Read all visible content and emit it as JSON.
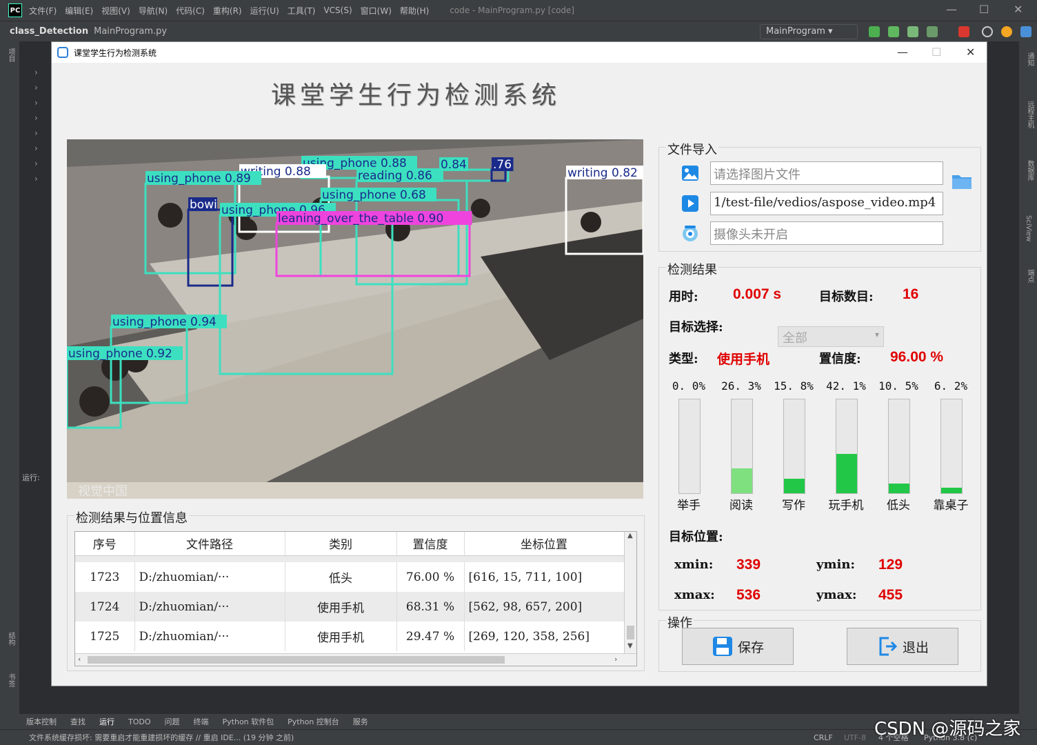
{
  "ide": {
    "logo": "PC",
    "menu": [
      "文件(F)",
      "编辑(E)",
      "视图(V)",
      "导航(N)",
      "代码(C)",
      "重构(R)",
      "运行(U)",
      "工具(T)",
      "VCS(S)",
      "窗口(W)",
      "帮助(H)"
    ],
    "title": "code - MainProgram.py [code]",
    "breadcrumb_project": "class_Detection",
    "breadcrumb_file": "MainProgram.py",
    "run_config": "MainProgram",
    "run_label": "运行:",
    "left_tab": "项目",
    "right_tabs": [
      "通知",
      "远程主机",
      "数据库",
      "SciView",
      "端点"
    ],
    "left_bottom_tabs": [
      "结构",
      "书签"
    ],
    "bottom_tabs": [
      "版本控制",
      "查找",
      "运行",
      "TODO",
      "问题",
      "终端",
      "Python 软件包",
      "Python 控制台",
      "服务"
    ],
    "status_message": "文件系统缓存损坏: 需要重启才能重建损坏的缓存 // 重启 IDE... (19 分钟 之前)",
    "status_right": [
      "CRLF",
      "UTF-8",
      "4 个空格",
      "Python 3.8 (c)"
    ],
    "watermark": "CSDN @源码之家"
  },
  "app": {
    "window_title": "课堂学生行为检测系统",
    "heading": "课堂学生行为检测系统",
    "video_watermark": "视觉中国",
    "detections": [
      {
        "label": "using_phone 0.88",
        "color": "#3ce0c0"
      },
      {
        "label": "writing 0.88",
        "color": "#ffffff"
      },
      {
        "label": "0.84",
        "color": "#3ce0c0"
      },
      {
        "label": ".76",
        "color": "#1a2a8a"
      },
      {
        "label": "writing 0.82",
        "color": "#ffffff"
      },
      {
        "label": "using_phone 0.89",
        "color": "#3ce0c0"
      },
      {
        "label": "reading 0.86",
        "color": "#3ce0c0"
      },
      {
        "label": "using_phone 0.68",
        "color": "#3ce0c0"
      },
      {
        "label": "bowi",
        "color": "#1a2a8a"
      },
      {
        "label": "using_phone 0.96",
        "color": "#3ce0c0"
      },
      {
        "label": "leaning_over_the_table 0.90",
        "color": "#ee44dd"
      },
      {
        "label": "using_phone 0.94",
        "color": "#3ce0c0"
      },
      {
        "label": "using_phone 0.92",
        "color": "#3ce0c0"
      }
    ],
    "file_import": {
      "title": "文件导入",
      "image_placeholder": "请选择图片文件",
      "video_path": "1/test-file/vedios/aspose_video.mp4",
      "camera_placeholder": "摄像头未开启"
    },
    "results": {
      "title": "检测结果",
      "time_label": "用时:",
      "time_value": "0.007 s",
      "count_label": "目标数目:",
      "count_value": "16",
      "select_label": "目标选择:",
      "select_value": "全部",
      "type_label": "类型:",
      "type_value": "使用手机",
      "conf_label": "置信度:",
      "conf_value": "96.00 %",
      "bars": [
        {
          "pct_label": "0. 0%",
          "value": 0.0,
          "name": "举手"
        },
        {
          "pct_label": "26. 3%",
          "value": 26.3,
          "name": "阅读"
        },
        {
          "pct_label": "15. 8%",
          "value": 15.8,
          "name": "写作"
        },
        {
          "pct_label": "42. 1%",
          "value": 42.1,
          "name": "玩手机"
        },
        {
          "pct_label": "10. 5%",
          "value": 10.5,
          "name": "低头"
        },
        {
          "pct_label": "6. 2%",
          "value": 6.2,
          "name": "靠桌子"
        }
      ],
      "position_label": "目标位置:",
      "xmin_label": "xmin:",
      "xmin_value": "339",
      "ymin_label": "ymin:",
      "ymin_value": "129",
      "xmax_label": "xmax:",
      "xmax_value": "536",
      "ymax_label": "ymax:",
      "ymax_value": "455"
    },
    "operations": {
      "title": "操作",
      "save_label": "保存",
      "exit_label": "退出"
    },
    "table": {
      "title": "检测结果与位置信息",
      "headers": [
        "序号",
        "文件路径",
        "类别",
        "置信度",
        "坐标位置"
      ],
      "rows": [
        {
          "id": "1723",
          "path": "D:/zhuomian/···",
          "cls": "低头",
          "conf": "76.00 %",
          "box": "[616, 15, 711, 100]"
        },
        {
          "id": "1724",
          "path": "D:/zhuomian/···",
          "cls": "使用手机",
          "conf": "68.31 %",
          "box": "[562, 98, 657, 200]"
        },
        {
          "id": "1725",
          "path": "D:/zhuomian/···",
          "cls": "使用手机",
          "conf": "29.47 %",
          "box": "[269, 120, 358, 256]"
        }
      ]
    }
  }
}
